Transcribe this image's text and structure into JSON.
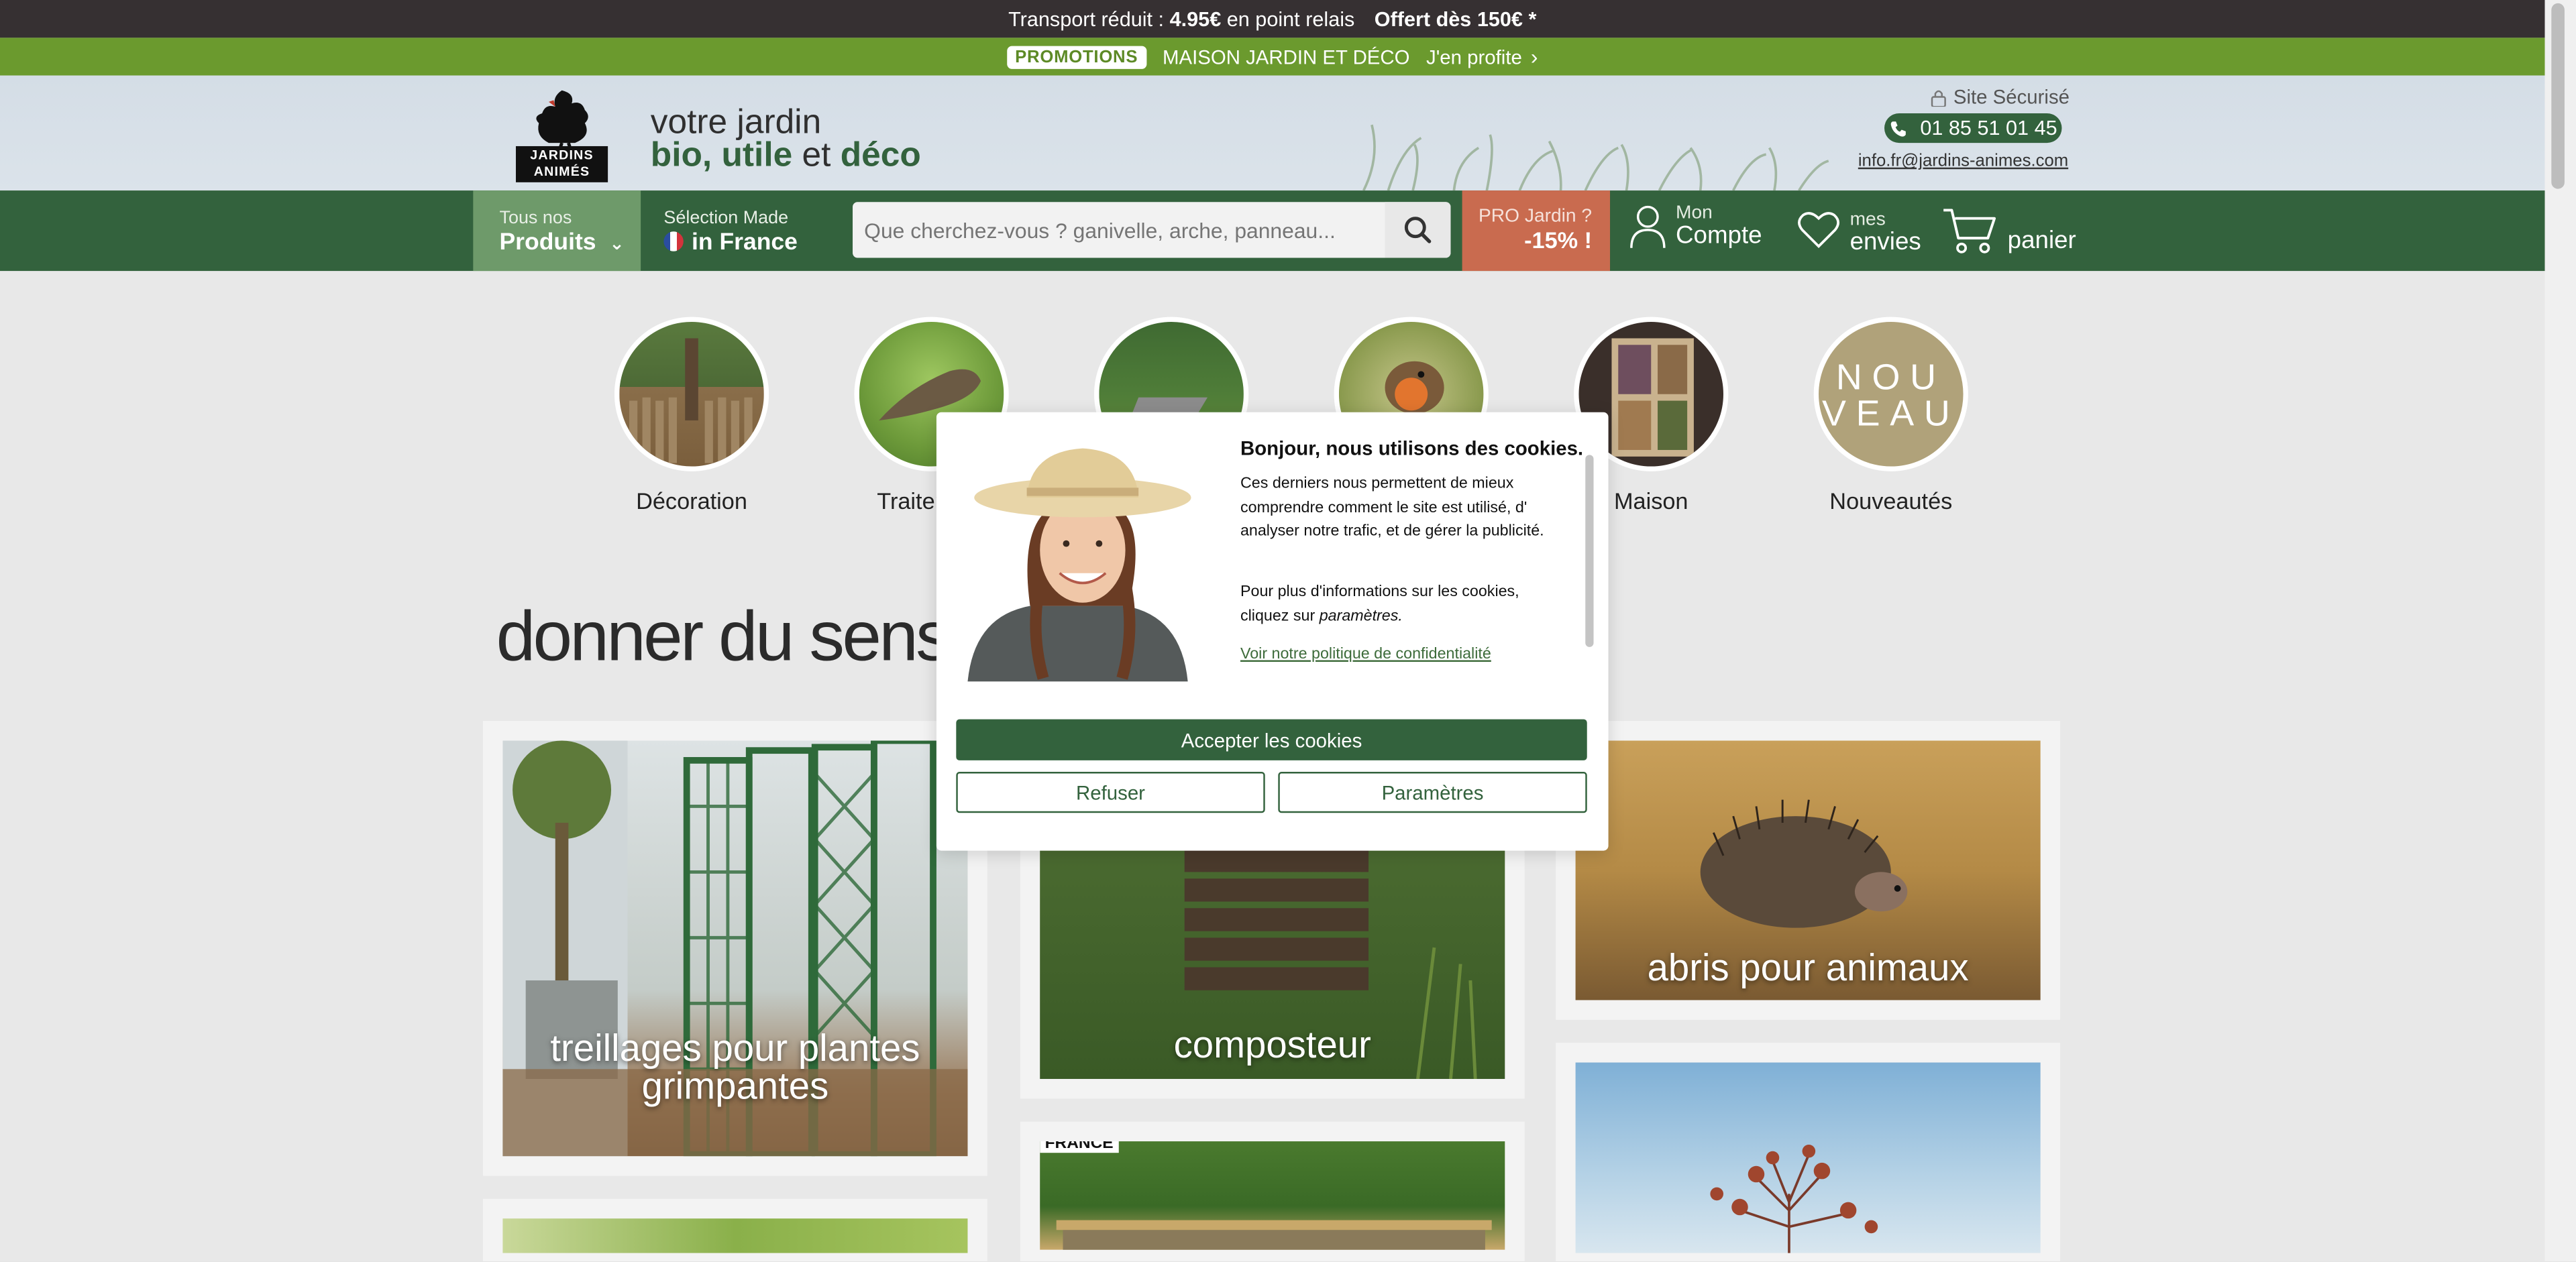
{
  "topbar": {
    "shipping_prefix": "Transport réduit :",
    "shipping_price": "4.95€",
    "shipping_suffix": "en point relais",
    "free_shipping": "Offert dès 150€ *"
  },
  "promobar": {
    "badge": "PROMOTIONS",
    "text": "MAISON JARDIN ET DÉCO",
    "cta": "J'en profite"
  },
  "header": {
    "logo_text_1": "JARDINS",
    "logo_text_2": "ANIMÉS",
    "tagline_line1": "votre jardin",
    "tagline_bio": "bio, utile",
    "tagline_et": "et",
    "tagline_deco": "déco",
    "secure_label": "Site Sécurisé",
    "phone": "01 85 51 01 45",
    "email": "info.fr@jardins-animes.com"
  },
  "nav": {
    "products_small": "Tous nos",
    "products_big": "Produits",
    "selection_small": "Sélection Made",
    "selection_big": "in France",
    "search_placeholder": "Que cherchez-vous ? ganivelle, arche, panneau...",
    "pro_small": "PRO Jardin ?",
    "pro_big": "-15% !",
    "account_small": "Mon",
    "account_big": "Compte",
    "wishlist_small": "mes",
    "wishlist_big": "envies",
    "cart_label": "panier"
  },
  "categories": [
    {
      "label": "Décoration"
    },
    {
      "label": "Traitement"
    },
    {
      "label": ""
    },
    {
      "label": ""
    },
    {
      "label": "Maison"
    },
    {
      "label": "Nouveautés",
      "badge": "NOU VEAU"
    }
  ],
  "headline": "donner du sens",
  "cards": [
    {
      "caption": "treillages pour plantes grimpantes"
    },
    {
      "caption": "composteur"
    },
    {
      "caption": "abris pour animaux"
    },
    {
      "caption": "FRANCE"
    }
  ],
  "cookie_modal": {
    "title": "Bonjour, nous utilisons des cookies.",
    "paragraph1": "Ces derniers nous permettent de mieux comprendre comment le site est utilisé, d' analyser notre trafic, et de gérer la publicité.",
    "paragraph2_prefix": "Pour plus d'informations sur les cookies, cliquez sur",
    "paragraph2_link": "paramètres.",
    "privacy_link": "Voir notre politique de confidentialité",
    "accept_label": "Accepter les cookies",
    "refuse_label": "Refuser",
    "settings_label": "Paramètres"
  },
  "colors": {
    "brand_green": "#33623d",
    "promo_green": "#6b9a2e",
    "pro_terracotta": "#c96b4f",
    "topbar_dark": "#363032"
  }
}
